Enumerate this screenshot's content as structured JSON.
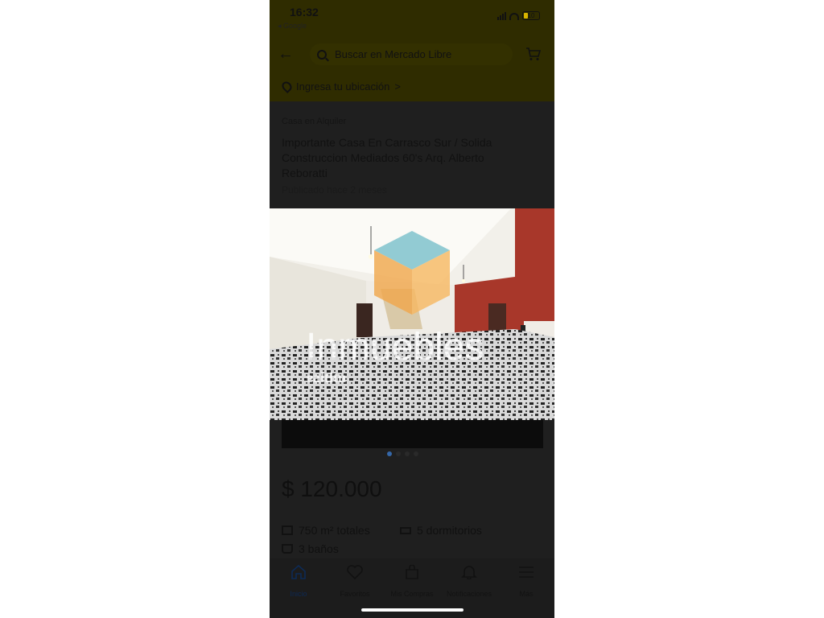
{
  "status_bar": {
    "time": "16:32",
    "back_app": "◂ Google",
    "battery": "10"
  },
  "header": {
    "search_placeholder": "Buscar en Mercado Libre",
    "location": "Ingresa tu ubicación",
    "location_chevron": ">"
  },
  "listing": {
    "category": "Casa en Alquiler",
    "title": "Importante Casa En Carrasco Sur / Solida Construccion Mediados 60's Arq. Alberto Reboratti",
    "published": "Publicado hace 2 meses",
    "watermark": "Inmuebles",
    "watermark_sub": "ealtitu",
    "price": "$ 120.000",
    "features": [
      "750 m² totales",
      "5 dormitorios",
      "3 baños"
    ]
  },
  "carousel": {
    "count": 4,
    "active": 0
  },
  "bottom_nav": [
    {
      "label": "Inicio",
      "icon": "home-icon",
      "active": true
    },
    {
      "label": "Favoritos",
      "icon": "heart-icon",
      "active": false
    },
    {
      "label": "Mis Compras",
      "icon": "bag-icon",
      "active": false
    },
    {
      "label": "Notificaciones",
      "icon": "bell-icon",
      "active": false
    },
    {
      "label": "Más",
      "icon": "menu-icon",
      "active": false
    }
  ],
  "colors": {
    "header_bg": "#2f2c00",
    "overlay_bg": "#1f1f1f",
    "nav_active": "#3567a8",
    "wall_red": "#a8372a"
  }
}
